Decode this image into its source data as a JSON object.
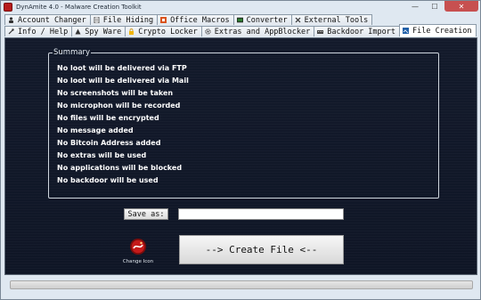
{
  "window": {
    "title": "DynAmite 4.0 - Malware Creation Toolkit",
    "minimize_glyph": "—",
    "maximize_glyph": "☐",
    "close_glyph": "✕"
  },
  "tabs_row1": [
    {
      "label": "Account Changer",
      "icon": "person-icon"
    },
    {
      "label": "File Hiding",
      "icon": "document-icon"
    },
    {
      "label": "Office Macros",
      "icon": "office-icon"
    },
    {
      "label": "Converter",
      "icon": "monitor-icon"
    },
    {
      "label": "External Tools",
      "icon": "tools-icon"
    }
  ],
  "tabs_row2": [
    {
      "label": "Info / Help",
      "icon": "help-icon"
    },
    {
      "label": "Spy Ware",
      "icon": "spy-icon"
    },
    {
      "label": "Crypto Locker",
      "icon": "lock-icon"
    },
    {
      "label": "Extras and AppBlocker",
      "icon": "gear-icon"
    },
    {
      "label": "Backdoor Import",
      "icon": "keyboard-icon"
    },
    {
      "label": "File Creation",
      "icon": "file-creation-icon",
      "active": true
    }
  ],
  "summary": {
    "legend": "Summary",
    "lines": [
      "No loot will be delivered via FTP",
      "No loot will be delivered via Mail",
      "No screenshots will be taken",
      "No microphon will be recorded",
      "No files will be encrypted",
      "No message added",
      "No Bitcoin Address added",
      "No extras will be used",
      "No applications will be blocked",
      "No backdoor will be used"
    ]
  },
  "save": {
    "button_label": "Save as:",
    "value": ""
  },
  "change_icon": {
    "label": "Change Icon"
  },
  "create": {
    "button_label": "--> Create File <--"
  },
  "progress": {
    "value": 0
  },
  "colors": {
    "content_background": "#121a2b",
    "text": "#ffffff",
    "active_tab": "#ffffff"
  }
}
